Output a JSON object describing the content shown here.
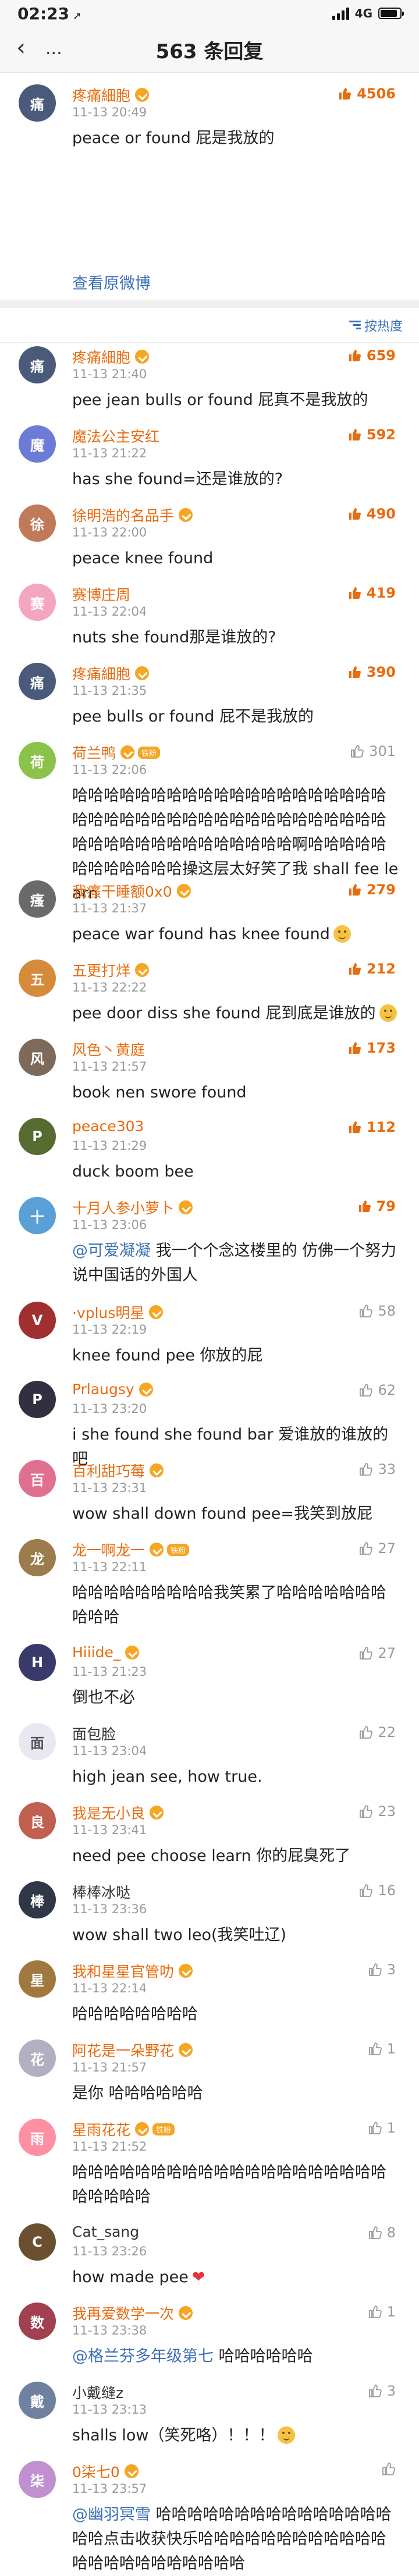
{
  "status": {
    "time": "02:23",
    "network": "4G"
  },
  "nav": {
    "title": "563 条回复",
    "more": "..."
  },
  "main_comment": {
    "name": "疼痛細胞",
    "time": "11-13 20:49",
    "likes": "4506",
    "text": "peace or found 屁是我放的",
    "view_original": "查看原微博"
  },
  "sort": {
    "label": "按热度"
  },
  "replies": [
    {
      "name": "疼痛細胞",
      "time": "11-13 21:40",
      "likes": "659",
      "text": "pee jean bulls or found 屁真不是我放的",
      "hot": true
    },
    {
      "name": "魔法公主安红",
      "time": "11-13 21:22",
      "likes": "592",
      "text": "has she found=还是谁放的?",
      "hot": true
    },
    {
      "name": "徐明浩的名品手",
      "time": "11-13 22:00",
      "likes": "490",
      "text": "peace knee found",
      "hot": true
    },
    {
      "name": "赛博庄周",
      "time": "11-13 22:04",
      "likes": "419",
      "text": "nuts she found那是谁放的?",
      "hot": true
    },
    {
      "name": "疼痛細胞",
      "time": "11-13 21:35",
      "likes": "390",
      "text": "pee bulls or found 屁不是我放的",
      "hot": true
    },
    {
      "name": "荷兰鸭",
      "tag": "铁粉",
      "time": "11-13 22:06",
      "likes": "301",
      "text": "哈哈哈哈哈哈哈哈哈哈哈哈哈哈哈哈哈哈哈哈哈哈哈哈哈哈哈哈哈哈哈哈哈哈哈哈哈哈哈哈哈哈哈哈哈哈哈哈哈哈哈哈哈哈啊哈哈哈哈哈哈哈哈哈哈哈哈操这层太好笑了我 shall fee learn",
      "hot": false
    },
    {
      "name": "我瘙干睡额0x0",
      "time": "11-13 21:37",
      "likes": "279",
      "text": "peace war found has knee found",
      "hot": true
    },
    {
      "name": "五更打烊",
      "time": "11-13 22:22",
      "likes": "212",
      "text": "pee door diss she found 屁到底是谁放的",
      "hot": true
    },
    {
      "name": "风色丶黄庭",
      "time": "11-13 21:57",
      "likes": "173",
      "text": "book nen swore found",
      "hot": true
    },
    {
      "name": "peace303",
      "time": "11-13 21:29",
      "likes": "112",
      "text": "duck boom bee",
      "hot": true
    },
    {
      "name": "十月人参小萝卜",
      "time": "11-13 23:06",
      "likes": "79",
      "mention": "@可爱凝凝",
      "text": " 我一个个念这楼里的 仿佛一个努力说中国话的外国人",
      "hot": true
    },
    {
      "name": "·vplus明星",
      "time": "11-13 22:19",
      "likes": "58",
      "text": "knee found pee 你放的屁",
      "hot": false
    },
    {
      "name": "Prlaugsy",
      "time": "11-13 23:20",
      "likes": "62",
      "text": "i she found she found bar 爱谁放的谁放的吧",
      "hot": false
    },
    {
      "name": "百利甜巧莓",
      "time": "11-13 23:31",
      "likes": "33",
      "text": "wow shall down found pee=我笑到放屁",
      "hot": false
    },
    {
      "name": "龙一啊龙一",
      "tag": "铁粉",
      "time": "11-13 22:11",
      "likes": "27",
      "text": "哈哈哈哈哈哈哈哈哈我笑累了哈哈哈哈哈哈哈哈哈哈",
      "hot": false
    },
    {
      "name": "Hiiide_",
      "time": "11-13 21:23",
      "likes": "27",
      "text": "倒也不必",
      "hot": false
    },
    {
      "name": "面包脸",
      "time": "11-13 23:04",
      "likes": "22",
      "text": "high jean see, how true.",
      "hot": false
    },
    {
      "name": "我是无小良",
      "time": "11-13 23:41",
      "likes": "23",
      "text": "need pee choose learn 你的屁臭死了",
      "hot": false
    },
    {
      "name": "棒棒冰哒",
      "time": "11-13 23:36",
      "likes": "16",
      "text": "wow  shall two leo(我笑吐辽)",
      "hot": false
    },
    {
      "name": "我和星星官管叻",
      "time": "11-13 22:14",
      "likes": "3",
      "text": "哈哈哈哈哈哈哈哈",
      "hot": false
    },
    {
      "name": "阿花是一朵野花",
      "time": "11-13 21:57",
      "likes": "1",
      "text": "是你 哈哈哈哈哈哈",
      "hot": false
    },
    {
      "name": "星雨花花",
      "tag": "铁粉",
      "time": "11-13 21:52",
      "likes": "1",
      "text": "哈哈哈哈哈哈哈哈哈哈哈哈哈哈哈哈哈哈哈哈哈哈哈哈哈",
      "hot": false
    },
    {
      "name": "Cat_sang",
      "time": "11-13 23:26",
      "likes": "8",
      "text": "how made pee",
      "hot": false
    },
    {
      "name": "我再爱数学一次",
      "time": "11-13 23:38",
      "likes": "1",
      "mention": "@格兰芬多年级第七",
      "text": " 哈哈哈哈哈哈",
      "hot": false
    },
    {
      "name": "小戴缝z",
      "time": "11-13 23:13",
      "likes": "3",
      "text": "shalls low（笑死咯）！！！",
      "hot": false
    },
    {
      "name": "0柒七0",
      "time": "11-13 23:57",
      "likes": "",
      "mention": "@幽羽冥雪",
      "text": " 哈哈哈哈哈哈哈哈哈哈哈哈哈哈哈哈哈点击收获快乐哈哈哈哈哈哈哈哈哈哈哈哈哈哈哈哈哈哈哈哈哈哈哈",
      "hot": false
    }
  ],
  "colors": {
    "accent_orange": "#e86b0e",
    "link_blue": "#3b6fb5",
    "muted_gray": "#999999"
  }
}
